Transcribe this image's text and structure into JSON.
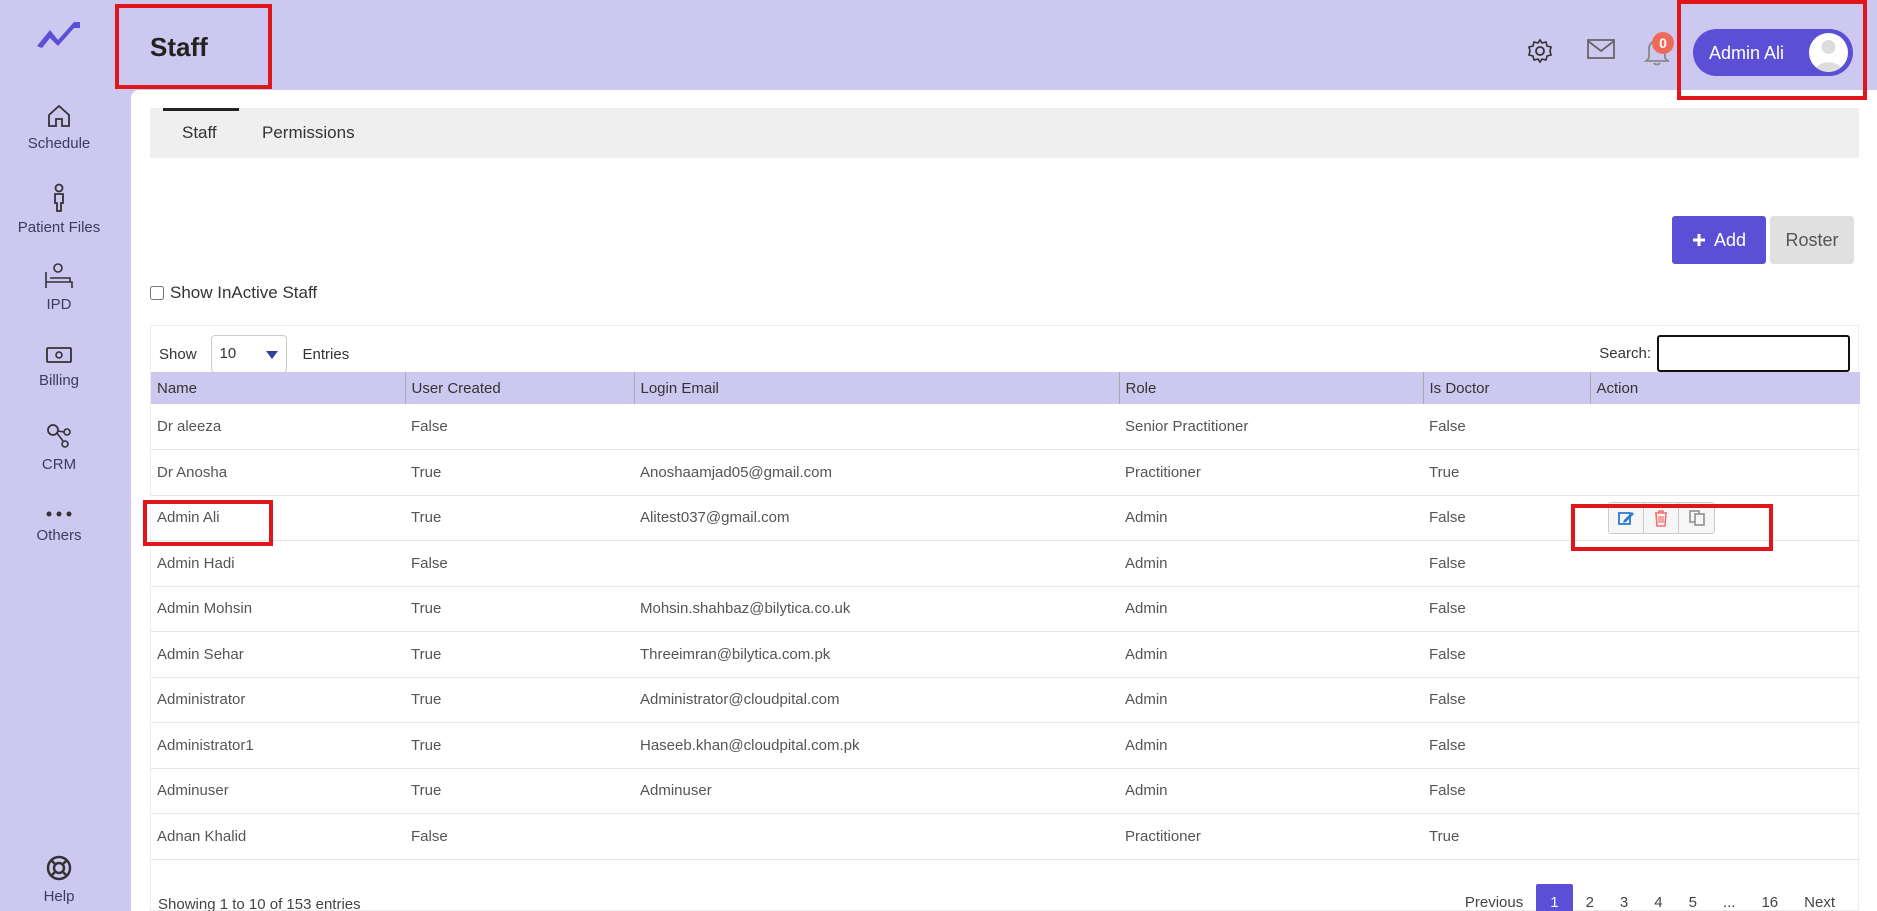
{
  "sidebar": {
    "items": [
      {
        "label": "Schedule",
        "icon": "home-icon"
      },
      {
        "label": "Patient Files",
        "icon": "person-icon"
      },
      {
        "label": "IPD",
        "icon": "bed-icon"
      },
      {
        "label": "Billing",
        "icon": "cash-icon"
      },
      {
        "label": "CRM",
        "icon": "network-icon"
      },
      {
        "label": "Others",
        "icon": "more-dots-icon"
      }
    ],
    "help_label": "Help"
  },
  "header": {
    "title": "Staff",
    "notification_count": "0",
    "user_name": "Admin Ali"
  },
  "tabs": [
    "Staff",
    "Permissions"
  ],
  "toolbar": {
    "add_label": "Add",
    "roster_label": "Roster"
  },
  "filters": {
    "inactive_label": "Show InActive Staff"
  },
  "table_controls": {
    "show_label": "Show",
    "entries_value": "10",
    "entries_label": "Entries",
    "search_label": "Search:"
  },
  "table": {
    "columns": [
      "Name",
      "User Created",
      "Login Email",
      "Role",
      "Is Doctor",
      "Action"
    ],
    "rows": [
      [
        "Dr aleeza",
        "False",
        "",
        "Senior Practitioner",
        "False"
      ],
      [
        "Dr Anosha",
        "True",
        "Anoshaamjad05@gmail.com",
        "Practitioner",
        "True"
      ],
      [
        "Admin Ali",
        "True",
        "Alitest037@gmail.com",
        "Admin",
        "False"
      ],
      [
        "Admin Hadi",
        "False",
        "",
        "Admin",
        "False"
      ],
      [
        "Admin Mohsin",
        "True",
        "Mohsin.shahbaz@bilytica.co.uk",
        "Admin",
        "False"
      ],
      [
        "Admin Sehar",
        "True",
        "Threeimran@bilytica.com.pk",
        "Admin",
        "False"
      ],
      [
        "Administrator",
        "True",
        "Administrator@cloudpital.com",
        "Admin",
        "False"
      ],
      [
        "Administrator1",
        "True",
        "Haseeb.khan@cloudpital.com.pk",
        "Admin",
        "False"
      ],
      [
        "Adminuser",
        "True",
        "Adminuser",
        "Admin",
        "False"
      ],
      [
        "Adnan Khalid",
        "False",
        "",
        "Practitioner",
        "True"
      ]
    ]
  },
  "footer": {
    "info": "Showing 1 to 10 of 153 entries",
    "pages": [
      "Previous",
      "1",
      "2",
      "3",
      "4",
      "5",
      "...",
      "16",
      "Next"
    ],
    "active_page": "1"
  },
  "colors": {
    "accent": "#5b4fd6",
    "sidebar_bg": "#ccc8f0",
    "annotation_red": "#e0161b"
  }
}
